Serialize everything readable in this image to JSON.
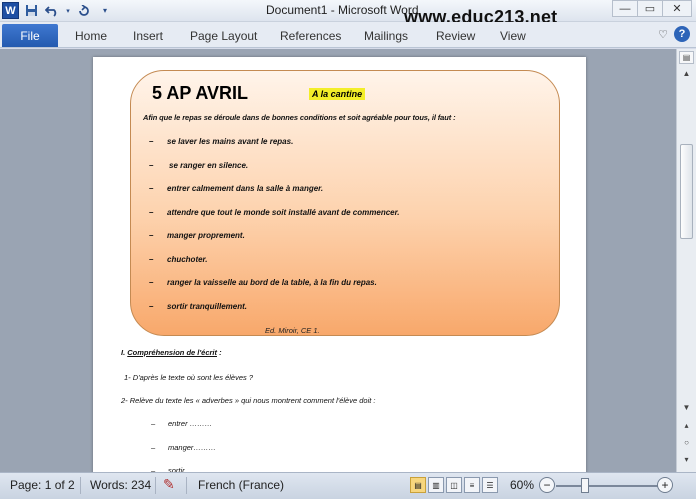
{
  "window": {
    "title": "Document1 - Microsoft Word",
    "watermark": "www.educ213.net",
    "controls": [
      "—",
      "▭",
      "✕"
    ]
  },
  "quick_access": {
    "icons": [
      "word-logo-icon",
      "save-icon",
      "undo-icon",
      "redo-icon",
      "customize-icon"
    ],
    "logo_letter": "W"
  },
  "ribbon": {
    "file_label": "File",
    "tabs": [
      "Home",
      "Insert",
      "Page Layout",
      "References",
      "Mailings",
      "Review",
      "View"
    ],
    "help_label": "?"
  },
  "document": {
    "heading": "5 AP AVRIL",
    "subtitle": "A la cantine",
    "intro": "Afin que le repas se déroule dans de bonnes conditions et soit agréable pour tous, il faut :",
    "rules": [
      "se laver les mains avant le repas.",
      "se ranger en silence.",
      "entrer calmement dans la salle à manger.",
      "attendre que tout le monde soit installé avant de commencer.",
      "manger proprement.",
      "chuchoter.",
      "ranger la vaisselle au bord de la table, à la fin du repas.",
      "sortir tranquillement."
    ],
    "rule_dash": "–",
    "source": "Ed. Miroir, CE 1.",
    "section_prefix": "I. ",
    "section_title": "Compréhension de l'écrit",
    "section_suffix": " :",
    "question1": "1- D'après le texte où sont les élèves ?",
    "question2": "2- Relève du texte les « adverbes » qui nous montrent comment l'élève  doit :",
    "answers": [
      "entrer ………",
      "manger………",
      "sortir"
    ]
  },
  "statusbar": {
    "page": "Page: 1 of 2",
    "words": "Words: 234",
    "language": "French (France)",
    "zoom": "60%",
    "zoom_level": 0.6
  }
}
